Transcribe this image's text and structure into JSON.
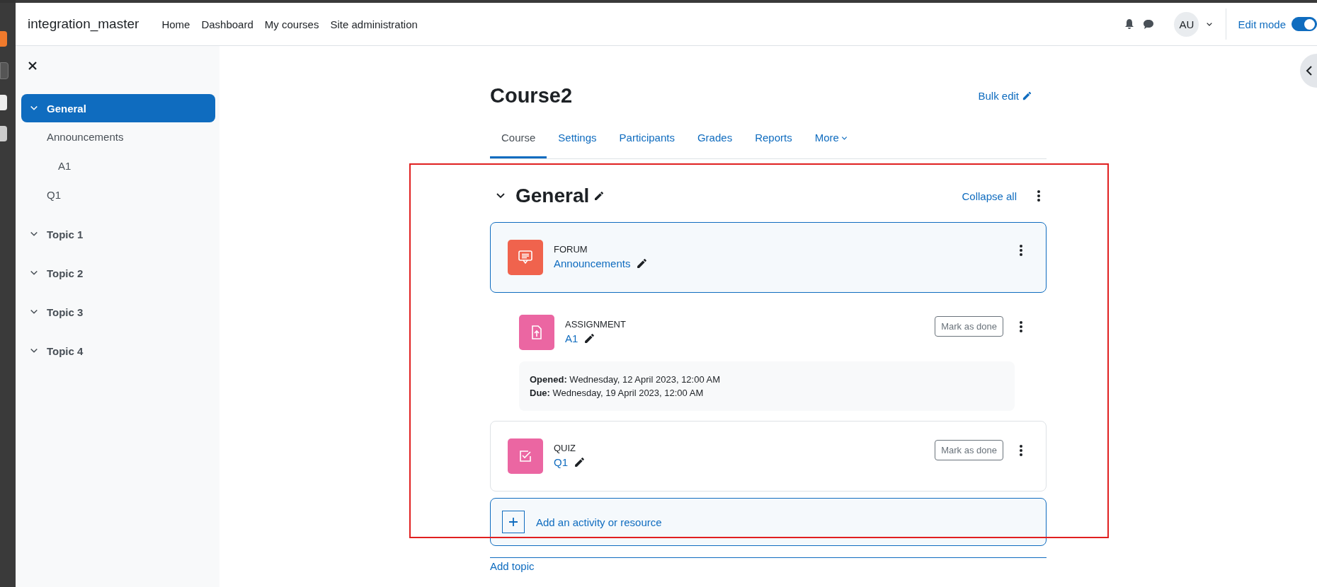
{
  "site_name": "integration_master",
  "nav_links": [
    {
      "label": "Home"
    },
    {
      "label": "Dashboard"
    },
    {
      "label": "My courses"
    },
    {
      "label": "Site administration"
    }
  ],
  "user_initials": "AU",
  "edit_mode": {
    "label": "Edit mode",
    "on": true
  },
  "course_index": [
    {
      "label": "General",
      "selected": true,
      "expanded": true,
      "children": [
        {
          "label": "Announcements",
          "children": [
            {
              "label": "A1"
            }
          ]
        },
        {
          "label": "Q1"
        }
      ]
    },
    {
      "label": "Topic 1",
      "selected": false,
      "expanded": true
    },
    {
      "label": "Topic 2",
      "selected": false,
      "expanded": true
    },
    {
      "label": "Topic 3",
      "selected": false,
      "expanded": true
    },
    {
      "label": "Topic 4",
      "selected": false,
      "expanded": true
    }
  ],
  "course_title": "Course2",
  "bulk_edit": "Bulk edit",
  "tabs": [
    {
      "label": "Course",
      "selected": true,
      "kind": "link"
    },
    {
      "label": "Settings",
      "selected": false,
      "kind": "link"
    },
    {
      "label": "Participants",
      "selected": false,
      "kind": "link"
    },
    {
      "label": "Grades",
      "selected": false,
      "kind": "link"
    },
    {
      "label": "Reports",
      "selected": false,
      "kind": "link"
    },
    {
      "label": "More",
      "selected": false,
      "kind": "menu"
    }
  ],
  "section": {
    "title": "General",
    "expanded": true,
    "collapse_all": "Collapse all",
    "activities": [
      {
        "kind": "forum",
        "type_label": "FORUM",
        "name": "Announcements",
        "highlighted": true,
        "indented": false
      },
      {
        "kind": "assignment",
        "type_label": "ASSIGNMENT",
        "name": "A1",
        "highlighted": false,
        "indented": true,
        "completion": "Mark as done",
        "dates": [
          "**Opened:** Wednesday, 12 April 2023, 12:00 AM",
          "**Due:** Wednesday, 19 April 2023, 12:00 AM"
        ]
      },
      {
        "kind": "quiz",
        "type_label": "QUIZ",
        "name": "Q1",
        "highlighted": false,
        "indented": false,
        "completion": "Mark as done"
      }
    ],
    "add_activity": "Add an activity or resource"
  },
  "add_topic": "Add topic"
}
